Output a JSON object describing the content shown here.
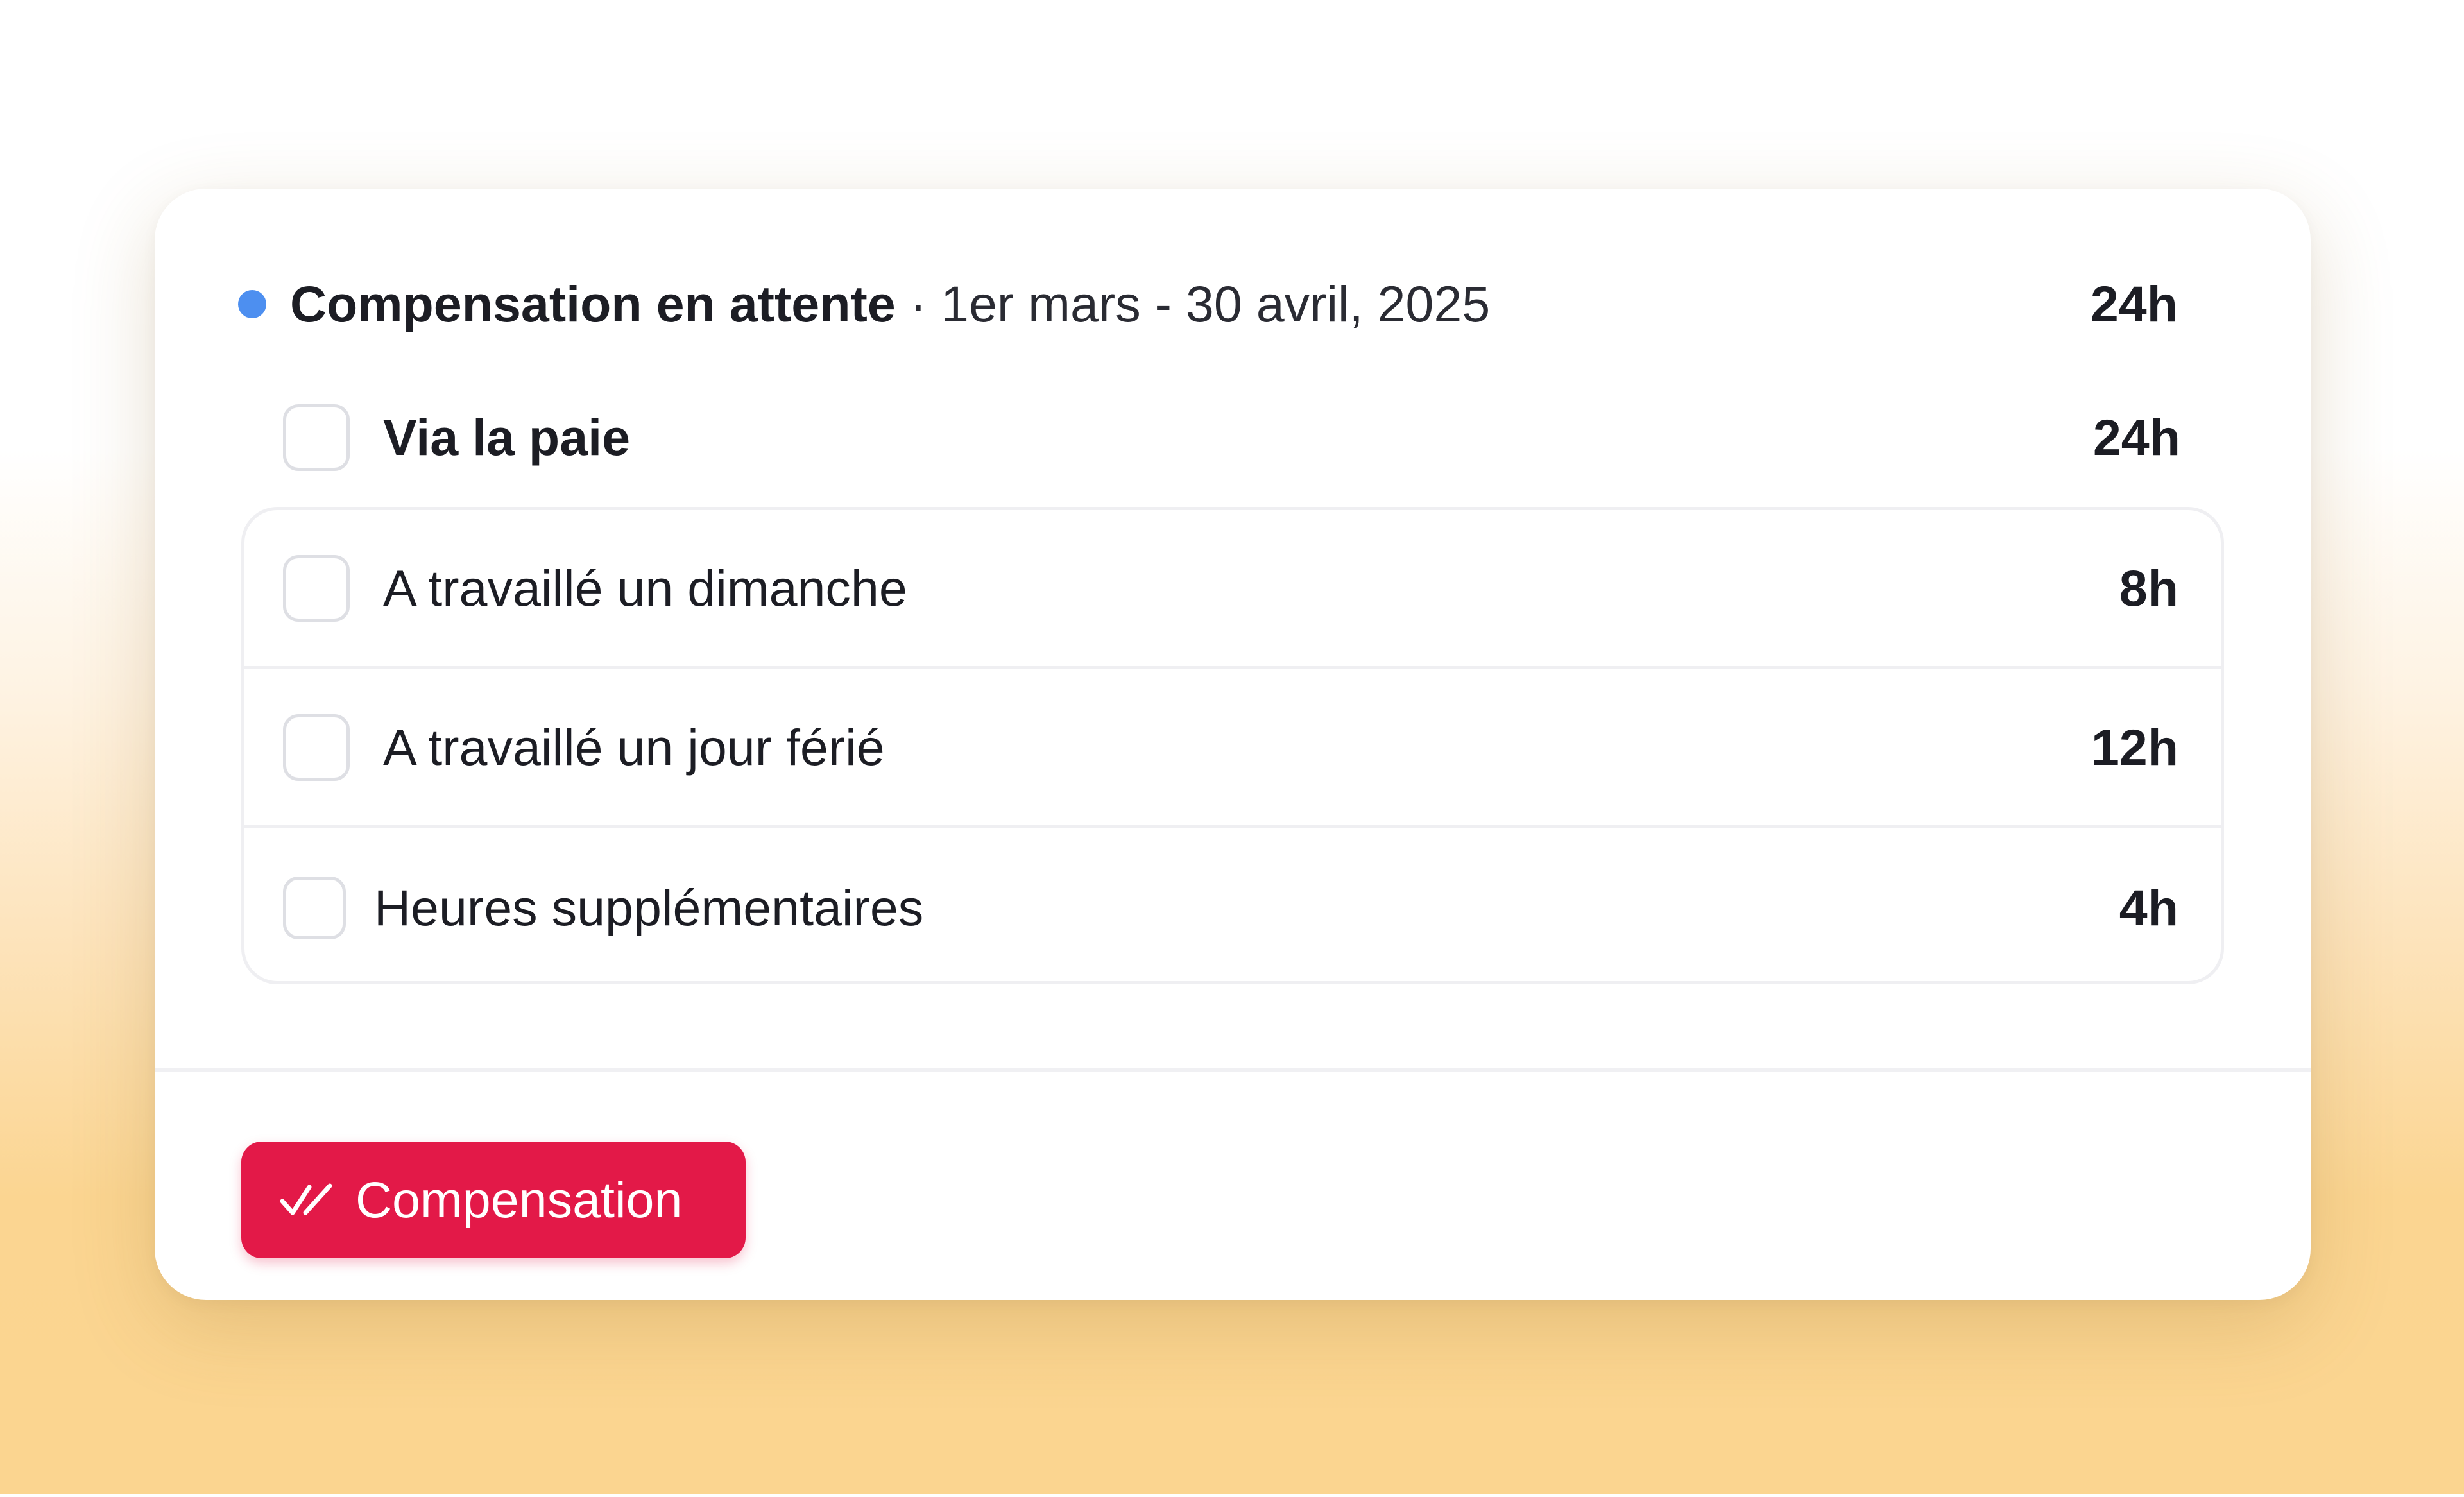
{
  "colors": {
    "status_dot": "#4d8ff0",
    "accent": "#e31948"
  },
  "summary": {
    "title": "Compensation en attente",
    "separator": "·",
    "period": "1er mars - 30 avril, 2025",
    "total_hours": "24h"
  },
  "group": {
    "label": "Via la paie",
    "hours": "24h",
    "checked": false
  },
  "items": [
    {
      "label": "A travaillé un dimanche",
      "hours": "8h",
      "checked": false
    },
    {
      "label": "A travaillé un jour férié",
      "hours": "12h",
      "checked": false
    },
    {
      "label": "Heures supplémentaires",
      "hours": "4h",
      "checked": false
    }
  ],
  "action_button": {
    "label": "Compensation",
    "icon": "double-check-icon"
  }
}
